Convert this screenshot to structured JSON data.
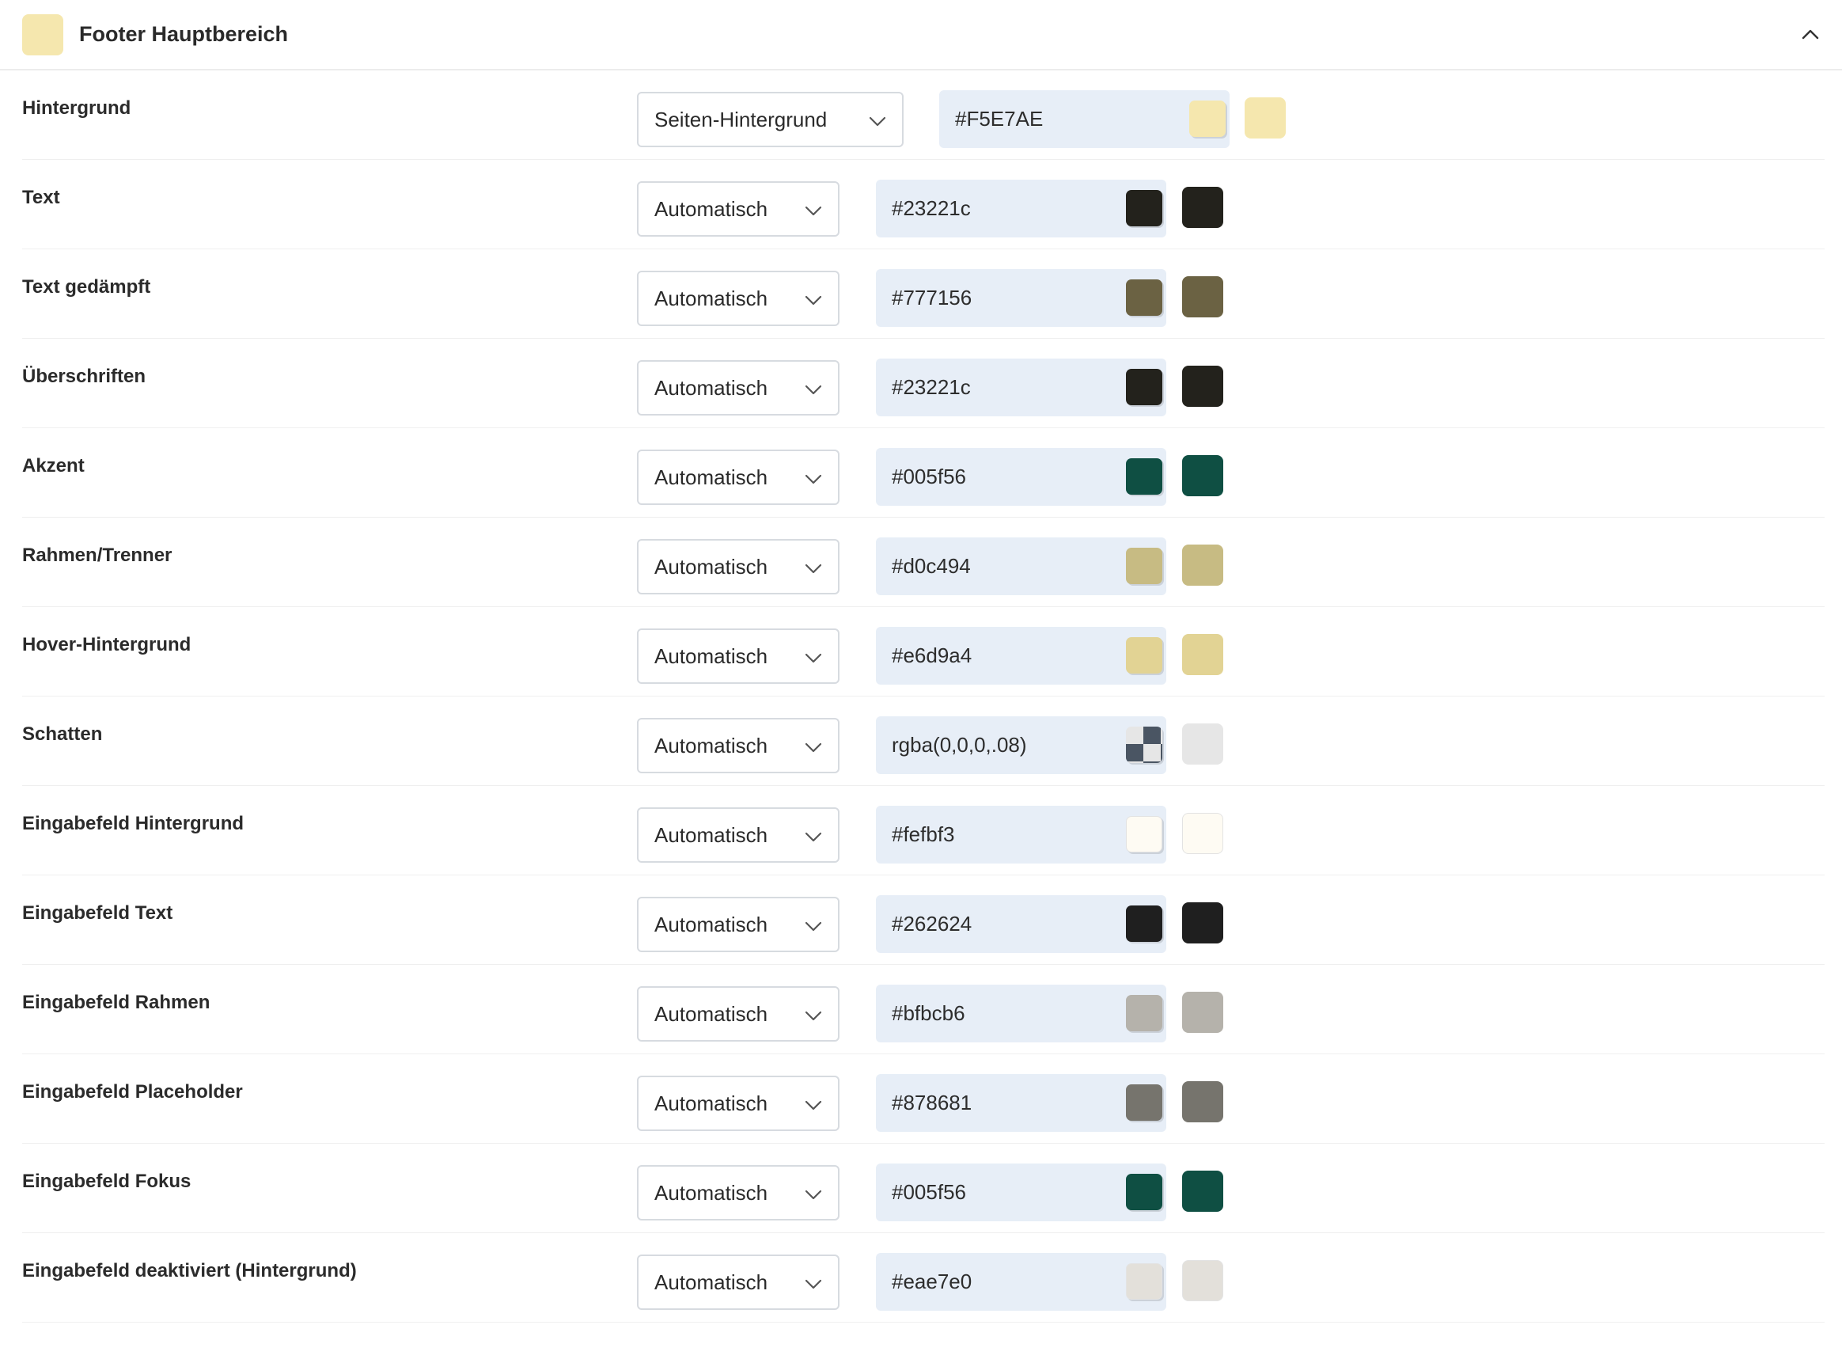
{
  "header": {
    "title": "Footer Hauptbereich",
    "swatch_color": "#F5E7AE",
    "collapse_icon": "chevron-up-icon"
  },
  "rows": [
    {
      "id": "hintergrund",
      "label": "Hintergrund",
      "select": "Seiten-Hintergrund",
      "value": "#F5E7AE",
      "color": "#F5E7AE"
    },
    {
      "id": "text",
      "label": "Text",
      "select": "Automatisch",
      "value": "#23221c",
      "color": "#23221c"
    },
    {
      "id": "text-gedaempft",
      "label": "Text gedämpft",
      "select": "Automatisch",
      "value": "#777156",
      "color": "#6b6243"
    },
    {
      "id": "ueberschriften",
      "label": "Überschriften",
      "select": "Automatisch",
      "value": "#23221c",
      "color": "#23221c"
    },
    {
      "id": "akzent",
      "label": "Akzent",
      "select": "Automatisch",
      "value": "#005f56",
      "color": "#0f4f43"
    },
    {
      "id": "rahmen-trenner",
      "label": "Rahmen/Trenner",
      "select": "Automatisch",
      "value": "#d0c494",
      "color": "#c7bb83"
    },
    {
      "id": "hover-hintergrund",
      "label": "Hover-Hintergrund",
      "select": "Automatisch",
      "value": "#e6d9a4",
      "color": "#e2d394"
    },
    {
      "id": "schatten",
      "label": "Schatten",
      "select": "Automatisch",
      "value": "rgba(0,0,0,.08)",
      "color": "#e6e6e6",
      "transparent": true
    },
    {
      "id": "eingabefeld-hintergrund",
      "label": "Eingabefeld Hintergrund",
      "select": "Automatisch",
      "value": "#fefbf3",
      "color": "#fefbf3",
      "light": true
    },
    {
      "id": "eingabefeld-text",
      "label": "Eingabefeld Text",
      "select": "Automatisch",
      "value": "#262624",
      "color": "#1f1f1f"
    },
    {
      "id": "eingabefeld-rahmen",
      "label": "Eingabefeld Rahmen",
      "select": "Automatisch",
      "value": "#bfbcb6",
      "color": "#b5b2ab"
    },
    {
      "id": "eingabefeld-placeholder",
      "label": "Eingabefeld Placeholder",
      "select": "Automatisch",
      "value": "#878681",
      "color": "#76746d"
    },
    {
      "id": "eingabefeld-fokus",
      "label": "Eingabefeld Fokus",
      "select": "Automatisch",
      "value": "#005f56",
      "color": "#0f4f43"
    },
    {
      "id": "eingabefeld-deaktiviert",
      "label": "Eingabefeld deaktiviert (Hintergrund)",
      "select": "Automatisch",
      "value": "#eae7e0",
      "color": "#e3e0da",
      "light": true
    }
  ]
}
